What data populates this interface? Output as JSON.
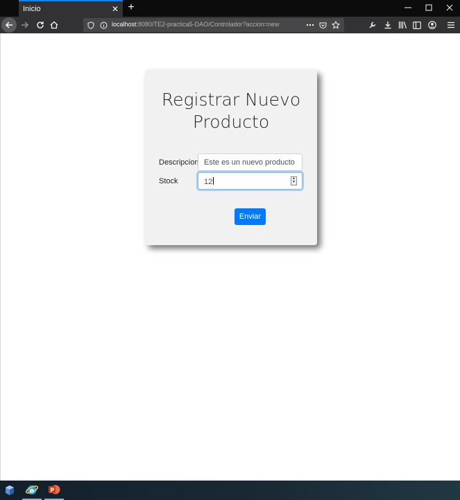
{
  "browser": {
    "tab_title": "Inicio",
    "url_host": "localhost",
    "url_path": ":8080/TE2-practica5-DAO/Controlador?accion=new"
  },
  "form": {
    "title": "Registrar Nuevo Producto",
    "description_label": "Descripcion",
    "description_value": "Este es un nuevo producto",
    "stock_label": "Stock",
    "stock_value": "12",
    "submit_label": "Enviar"
  },
  "colors": {
    "accent": "#0a84ff",
    "button": "#007bff",
    "card_bg": "#f1f1f1"
  },
  "taskbar": {
    "apps": [
      "app-icon",
      "internet-explorer-icon",
      "powerpoint-icon"
    ]
  }
}
